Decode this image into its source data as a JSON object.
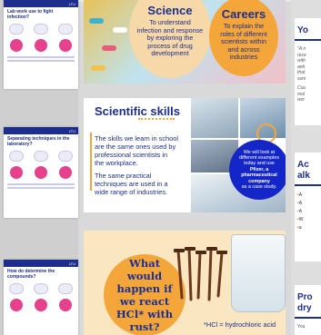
{
  "thumbnails": [
    {
      "title": "Lab work use to fight infection?",
      "tag": "LTU"
    },
    {
      "title": "Separating techniques in the laboratory?",
      "tag": "LTU"
    },
    {
      "title": "How do determine the compounds?",
      "tag": "LTU"
    }
  ],
  "slide_top": {
    "science_title": "Science",
    "science_text": "To understand infection and response by exploring the process of drug development",
    "careers_title": "Careers",
    "careers_text": "To explain the roles of different scientists within and across industries"
  },
  "slide_skills": {
    "title": "Scientific skills",
    "paragraph_1": "The skills we learn in school are the same ones used by professional scientists in the workplace.",
    "paragraph_2": "The same practical techniques are used in a wide range of industries.",
    "circle_pre": "We will look at different examples today and use",
    "circle_bold": "Pfizer, a pharmaceutical company",
    "circle_post": "as a case study."
  },
  "slide_question": {
    "question": "What would happen if we react HCl* with rust?",
    "footnote": "*HCl = hydrochloric acid"
  },
  "right_cards": [
    {
      "heading": "Yo",
      "lines": [
        "\"A n",
        "rece",
        "with",
        "anti",
        "that",
        "som",
        "Cou",
        "mol",
        "wor"
      ]
    },
    {
      "heading": "Ac",
      "heading2": "alk",
      "bullets": [
        "A",
        "A",
        "A",
        "W",
        "a"
      ]
    },
    {
      "heading": "Pro",
      "heading2": "dry",
      "lines": [
        "You"
      ]
    }
  ],
  "colors": {
    "navy": "#1d2e8c",
    "orange": "#f5a63b",
    "blue_circle": "#1526c8",
    "pink": "#e6418d"
  }
}
